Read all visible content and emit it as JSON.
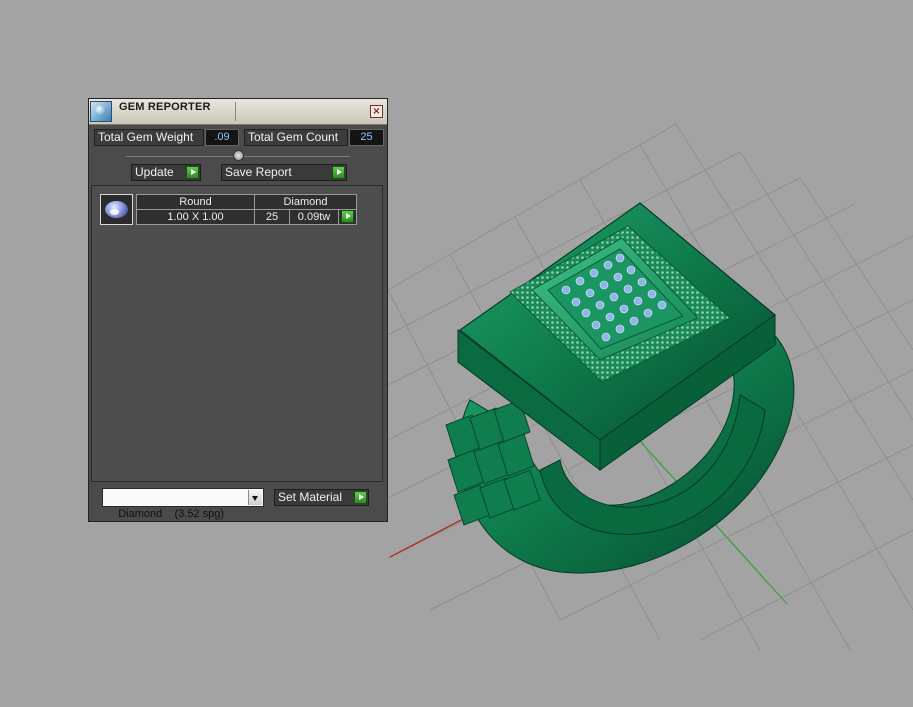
{
  "gem_reporter": {
    "title": "GEM REPORTER",
    "close_glyph": "×",
    "total_gem_weight_label": "Total Gem Weight",
    "total_gem_weight_value": ".09",
    "total_gem_count_label": "Total Gem Count",
    "total_gem_count_value": "25",
    "update_label": "Update",
    "save_report_label": "Save Report",
    "gem_rows": [
      {
        "shape": "Round",
        "material": "Diamond",
        "size": "1.00 X 1.00",
        "count": "25",
        "weight": "0.09tw"
      }
    ],
    "material_select_value": "Diamond    (3.52 spg)",
    "set_material_label": "Set Material"
  },
  "viewport": {
    "model_color": "#0e7a4b",
    "gem_color": "#8fb4e8",
    "grid_color": "#8c8c8c",
    "x_axis_color": "#b03020",
    "y_axis_color": "#3aa040"
  }
}
